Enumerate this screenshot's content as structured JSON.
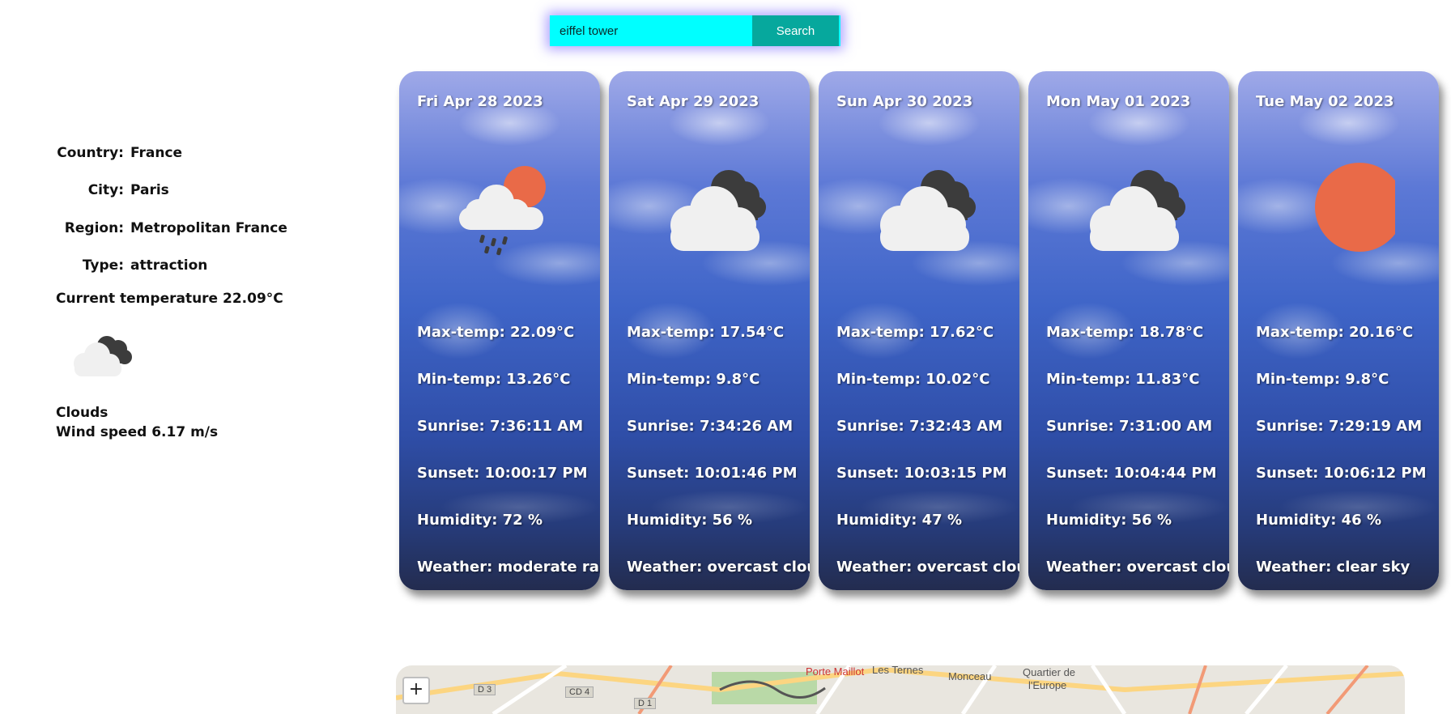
{
  "search": {
    "value": "eiffel tower",
    "button_label": "Search"
  },
  "location": {
    "rows": [
      {
        "key": "Country:",
        "value": "France"
      },
      {
        "key": "City:",
        "value": "Paris"
      },
      {
        "key": "Region:",
        "value": "Metropolitan France"
      },
      {
        "key": "Type:",
        "value": "attraction"
      }
    ],
    "current_temp": "Current temperature 22.09°C",
    "current_icon": "clouds-icon",
    "condition": "Clouds",
    "wind": "Wind speed 6.17 m/s"
  },
  "forecast": [
    {
      "date": "Fri Apr 28 2023",
      "icon": "rain-cloud-sun-icon",
      "max": "Max-temp: 22.09°C",
      "min": "Min-temp: 13.26°C",
      "sunrise": "Sunrise: 7:36:11 AM",
      "sunset": "Sunset: 10:00:17 PM",
      "humidity": "Humidity: 72 %",
      "weather": "Weather: moderate rain"
    },
    {
      "date": "Sat Apr 29 2023",
      "icon": "overcast-clouds-icon",
      "max": "Max-temp: 17.54°C",
      "min": "Min-temp: 9.8°C",
      "sunrise": "Sunrise: 7:34:26 AM",
      "sunset": "Sunset: 10:01:46 PM",
      "humidity": "Humidity: 56 %",
      "weather": "Weather: overcast clouds"
    },
    {
      "date": "Sun Apr 30 2023",
      "icon": "overcast-clouds-icon",
      "max": "Max-temp: 17.62°C",
      "min": "Min-temp: 10.02°C",
      "sunrise": "Sunrise: 7:32:43 AM",
      "sunset": "Sunset: 10:03:15 PM",
      "humidity": "Humidity: 47 %",
      "weather": "Weather: overcast clouds"
    },
    {
      "date": "Mon May 01 2023",
      "icon": "overcast-clouds-icon",
      "max": "Max-temp: 18.78°C",
      "min": "Min-temp: 11.83°C",
      "sunrise": "Sunrise: 7:31:00 AM",
      "sunset": "Sunset: 10:04:44 PM",
      "humidity": "Humidity: 56 %",
      "weather": "Weather: overcast clouds"
    },
    {
      "date": "Tue May 02 2023",
      "icon": "clear-sky-sun-icon",
      "max": "Max-temp: 20.16°C",
      "min": "Min-temp: 9.8°C",
      "sunrise": "Sunrise: 7:29:19 AM",
      "sunset": "Sunset: 10:06:12 PM",
      "humidity": "Humidity: 46 %",
      "weather": "Weather: clear sky"
    }
  ],
  "map": {
    "zoom_in": "+",
    "labels": [
      "Porte Maillot",
      "Les Ternes",
      "Monceau",
      "Quartier de",
      "l'Europe"
    ],
    "shields": [
      "D 3",
      "CD 4",
      "D 1"
    ]
  },
  "colors": {
    "search_bg": "#00ffff",
    "search_button": "#06a89d",
    "sun": "#e96a48",
    "dark_cloud": "#3c3c3c",
    "light_cloud": "#f0f0f0"
  }
}
